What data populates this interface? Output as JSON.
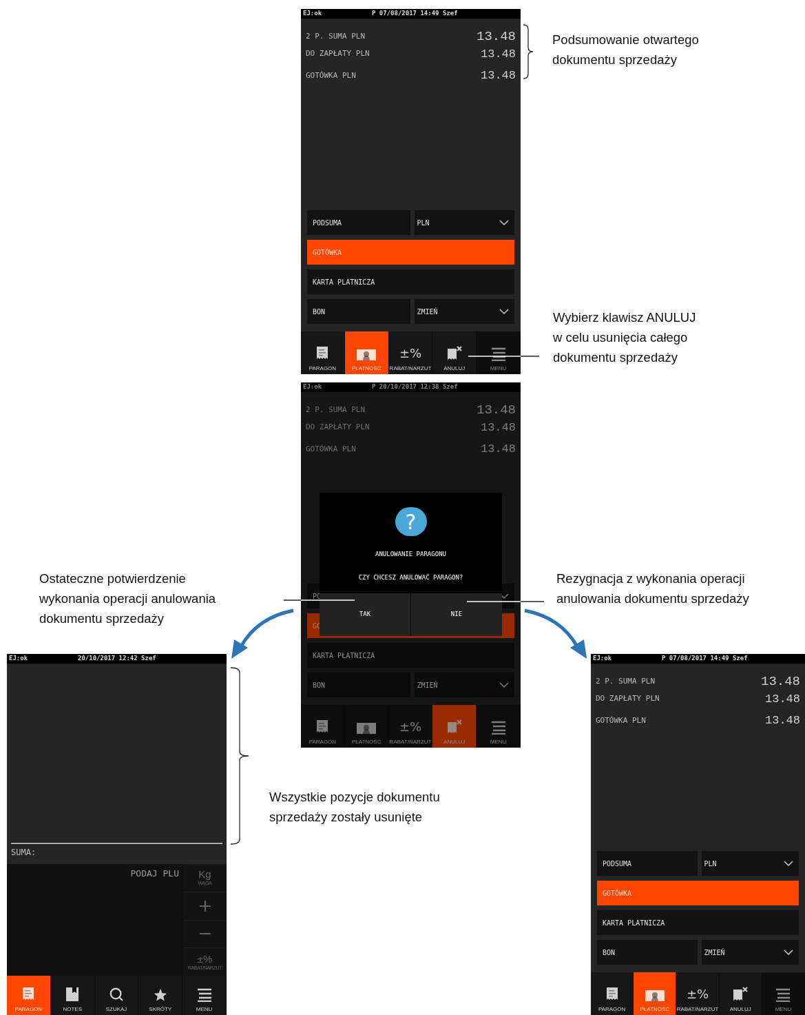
{
  "screens": [
    {
      "kind": "payment",
      "dimmed": false,
      "status": {
        "left": "EJ:ok",
        "center": "P 07/08/2017 14:49 Szef"
      },
      "summary": [
        {
          "label": "2 P. SUMA PLN",
          "value": "13.48"
        },
        {
          "label": "DO ZAPŁATY PLN",
          "value": "13.48"
        },
        {
          "label": "GOTÓWKA PLN",
          "value": "13.48"
        }
      ],
      "button_rows": [
        [
          {
            "kind": "button",
            "label": "PODSUMA",
            "selected": false
          },
          {
            "kind": "dropdown",
            "label": "PLN",
            "selected": false
          }
        ],
        [
          {
            "kind": "button",
            "label": "GOTÓWKA",
            "selected": true
          }
        ],
        [
          {
            "kind": "button",
            "label": "KARTA PLATNICZA",
            "selected": false
          }
        ],
        [
          {
            "kind": "button",
            "label": "BON",
            "selected": false
          },
          {
            "kind": "dropdown",
            "label": "ZMIEŃ",
            "selected": false
          }
        ]
      ],
      "nav": [
        {
          "kind": "receipt",
          "label": "PARAGON",
          "selected": false,
          "disabled": false
        },
        {
          "kind": "banknote",
          "label": "PŁATNOŚĆ",
          "selected": true,
          "disabled": false
        },
        {
          "kind": "glyph",
          "glyph": "±%",
          "label": "RABAT/NARZUT",
          "selected": false,
          "disabled": false
        },
        {
          "kind": "cancel",
          "label": "ANULUJ",
          "selected": false,
          "disabled": false
        },
        {
          "kind": "menu",
          "label": "MENU",
          "selected": false,
          "disabled": true
        }
      ]
    },
    {
      "kind": "payment",
      "dimmed": true,
      "status": {
        "left": "EJ:ok",
        "center": "P 20/10/2017 12:38 Szef"
      },
      "summary": [
        {
          "label": "2 P. SUMA PLN",
          "value": "13.48"
        },
        {
          "label": "DO ZAPŁATY PLN",
          "value": "13.48"
        },
        {
          "label": "GOTÓWKA PLN",
          "value": "13.48"
        }
      ],
      "button_rows": [
        [
          {
            "kind": "button",
            "label": "PC",
            "selected": false
          },
          {
            "kind": "dropdown",
            "selected": false
          }
        ],
        [
          {
            "kind": "button",
            "label": "GC",
            "selected": true
          }
        ],
        [
          {
            "kind": "button",
            "label": "KARTA PŁATNICZA",
            "selected": false
          }
        ],
        [
          {
            "kind": "button",
            "label": "BON",
            "selected": false
          },
          {
            "kind": "dropdown",
            "label": "ZMIEŃ",
            "selected": false
          }
        ]
      ],
      "nav": [
        {
          "kind": "receipt",
          "label": "PARAGON",
          "selected": false,
          "disabled": false
        },
        {
          "kind": "banknote",
          "label": "PŁATNOŚĆ",
          "selected": false,
          "disabled": false
        },
        {
          "kind": "glyph",
          "glyph": "±%",
          "label": "RABAT/NARZUT",
          "selected": false,
          "disabled": false
        },
        {
          "kind": "cancel",
          "label": "ANULUJ",
          "selected": true,
          "disabled": false
        },
        {
          "kind": "menu",
          "label": "MENU",
          "selected": false,
          "disabled": false
        }
      ],
      "dialog": {
        "symbol": "?",
        "title": "ANULOWANIE PARAGONU",
        "message": "CZY CHCESZ ANULOWAĆ PARAGON?",
        "buttons": [
          "TAK",
          "NIE"
        ]
      }
    },
    {
      "kind": "sale",
      "dimmed": false,
      "status": {
        "left": "EJ:ok",
        "center": "20/10/2017 12:42 Szef"
      },
      "total_label": "SUMA:",
      "prompt": "PODAJ PLU",
      "side_keys": [
        {
          "kind": "text",
          "label": "Kg",
          "caption": "WAGA"
        },
        {
          "kind": "plus"
        },
        {
          "kind": "minus"
        },
        {
          "kind": "text",
          "label": "±%",
          "caption": "RABAT/NARZUT"
        }
      ],
      "nav": [
        {
          "kind": "receipt",
          "label": "PARAGON",
          "selected": true,
          "disabled": false
        },
        {
          "kind": "notes",
          "label": "NOTES",
          "selected": false,
          "disabled": false
        },
        {
          "kind": "search",
          "label": "SZUKAJ",
          "selected": false,
          "disabled": false
        },
        {
          "kind": "star",
          "label": "SKRÓTY",
          "selected": false,
          "disabled": false
        },
        {
          "kind": "menu",
          "label": "MENU",
          "selected": false,
          "disabled": false
        }
      ]
    },
    {
      "kind": "payment",
      "dimmed": false,
      "status": {
        "left": "EJ:ok",
        "center": "P 07/08/2017 14:49 Szef"
      },
      "summary": [
        {
          "label": "2 P. SUMA PLN",
          "value": "13.48"
        },
        {
          "label": "DO ZAPŁATY PLN",
          "value": "13.48"
        },
        {
          "label": "GOTÓWKA PLN",
          "value": "13.48"
        }
      ],
      "button_rows": [
        [
          {
            "kind": "button",
            "label": "PODSUMA",
            "selected": false
          },
          {
            "kind": "dropdown",
            "label": "PLN",
            "selected": false
          }
        ],
        [
          {
            "kind": "button",
            "label": "GOTÓWKA",
            "selected": true
          }
        ],
        [
          {
            "kind": "button",
            "label": "KARTA PLATNICZA",
            "selected": false
          }
        ],
        [
          {
            "kind": "button",
            "label": "BON",
            "selected": false
          },
          {
            "kind": "dropdown",
            "label": "ZMIEŃ",
            "selected": false
          }
        ]
      ],
      "nav": [
        {
          "kind": "receipt",
          "label": "PARAGON",
          "selected": false,
          "disabled": false
        },
        {
          "kind": "banknote",
          "label": "PŁATNOŚĆ",
          "selected": true,
          "disabled": false
        },
        {
          "kind": "glyph",
          "glyph": "±%",
          "label": "RABAT/NARZUT",
          "selected": false,
          "disabled": false
        },
        {
          "kind": "cancel",
          "label": "ANULUJ",
          "selected": false,
          "disabled": false
        },
        {
          "kind": "menu",
          "label": "MENU",
          "selected": false,
          "disabled": true
        }
      ]
    }
  ],
  "annotations": [
    {
      "kind": "brace",
      "text": "Podsumowanie otwartego\ndokumentu sprzedaży"
    },
    {
      "kind": "line",
      "text": "Wybierz klawisz ANULUJ\nw celu usunięcia całego\ndokumentu sprzedaży"
    },
    {
      "kind": "line",
      "text": "Ostateczne potwierdzenie\nwykonania operacji anulowania\ndokumentu sprzedaży"
    },
    {
      "kind": "line",
      "text": "Rezygnacja z wykonania operacji\nanulowania dokumentu sprzedaży"
    },
    {
      "kind": "brace",
      "text": "Wszystkie pozycje dokumentu\nsprzedaży zostały usunięte"
    }
  ]
}
